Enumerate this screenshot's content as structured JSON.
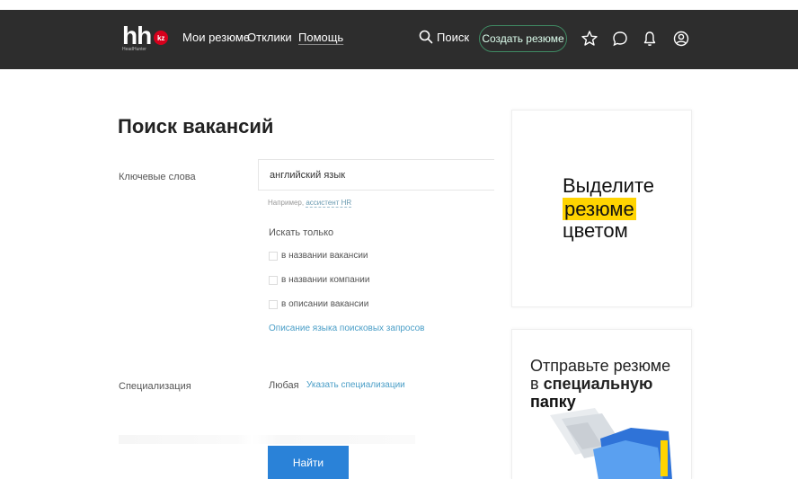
{
  "header": {
    "logo_text": "hh",
    "logo_badge": "kz",
    "logo_subtitle": "HeadHunter",
    "nav": [
      "Мои резюме",
      "Отклики",
      "Помощь"
    ],
    "search_label": "Поиск",
    "create_resume_label": "Создать резюме",
    "icons": [
      "star-icon",
      "chat-icon",
      "bell-icon",
      "profile-icon"
    ],
    "colors": {
      "background": "#2d2d2d",
      "accent_border": "#3f8a63",
      "logo_badge": "#d6001c"
    }
  },
  "form": {
    "title": "Поиск вакансий",
    "keywords_label": "Ключевые слова",
    "keywords_value": "английский язык",
    "example_prefix": "Например,",
    "example_link": "ассистент HR",
    "search_only_label": "Искать только",
    "checkboxes": [
      "в названии вакансии",
      "в названии компании",
      "в описании вакансии"
    ],
    "query_language_link": "Описание языка поисковых запросов",
    "specialization_label": "Специализация",
    "specialization_value": "Любая",
    "specialization_link": "Указать специализации",
    "submit_label": "Найти",
    "colors": {
      "primary_button": "#2a82d8",
      "link": "#4a9ec7"
    }
  },
  "promos": {
    "card1": {
      "line1": "Выделите",
      "highlight": "резюме",
      "line3": "цветом",
      "highlight_color": "#ffd400"
    },
    "card2": {
      "line1": "Отправьте резюме",
      "line2_prefix": "в",
      "line2_bold": "специальную",
      "line3": "папку"
    }
  }
}
